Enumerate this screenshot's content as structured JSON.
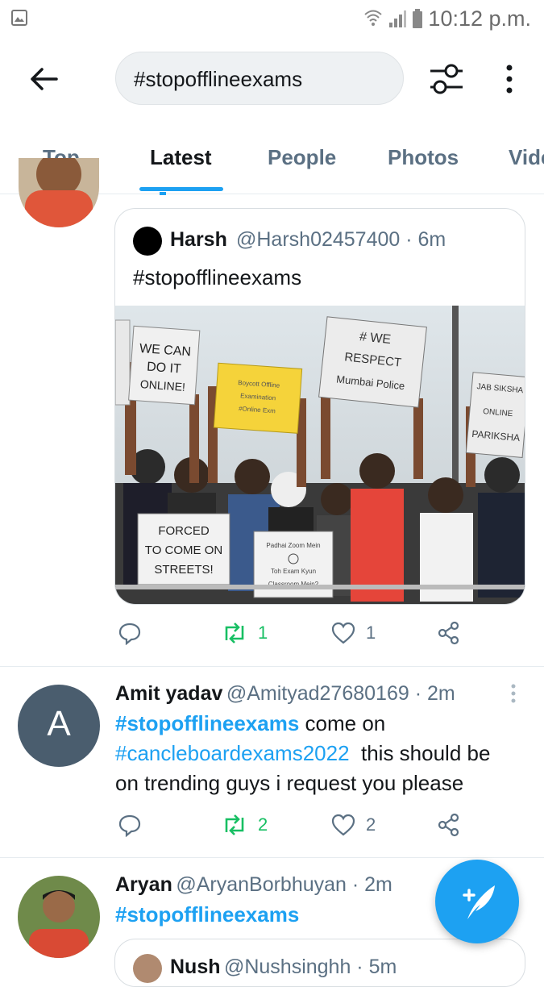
{
  "status_bar": {
    "time": "10:12 p.m."
  },
  "search": {
    "query": "#stopofflineexams"
  },
  "tabs": [
    {
      "label": "Top"
    },
    {
      "label": "Latest"
    },
    {
      "label": "People"
    },
    {
      "label": "Photos"
    },
    {
      "label": "Vide"
    }
  ],
  "quoted_tweet": {
    "name": "Harsh",
    "handle": "@Harsh02457400 · 6m",
    "text": "#stopofflineexams",
    "photo_signs": [
      "WE CAN DO IT ONLINE!",
      "# WE RESPECT Mumbai Police",
      "FORCED TO COME ON STREETS!"
    ]
  },
  "tweet1_actions": {
    "retweets": "1",
    "likes": "1"
  },
  "tweet2": {
    "avatar_letter": "A",
    "name": "Amit yadav",
    "handle": "@Amityad27680169 · 2m",
    "hashtag1": "#stopofflineexams",
    "text1": " come on",
    "hashtag2": "#cancleboardexams2022",
    "text2": "  this should be",
    "text3": "on trending guys i request you please",
    "retweets": "2",
    "likes": "2"
  },
  "tweet3": {
    "name": "Aryan",
    "handle": "@AryanBorbhuyan · 2m",
    "hashtag": "#stopofflineexams",
    "quote_name_partial": "Nush",
    "quote_handle_partial": "@Nushsinghh · 5m"
  },
  "colors": {
    "accent": "#1da1f2",
    "retweet_green": "#17bf63",
    "muted": "#5b7083"
  }
}
